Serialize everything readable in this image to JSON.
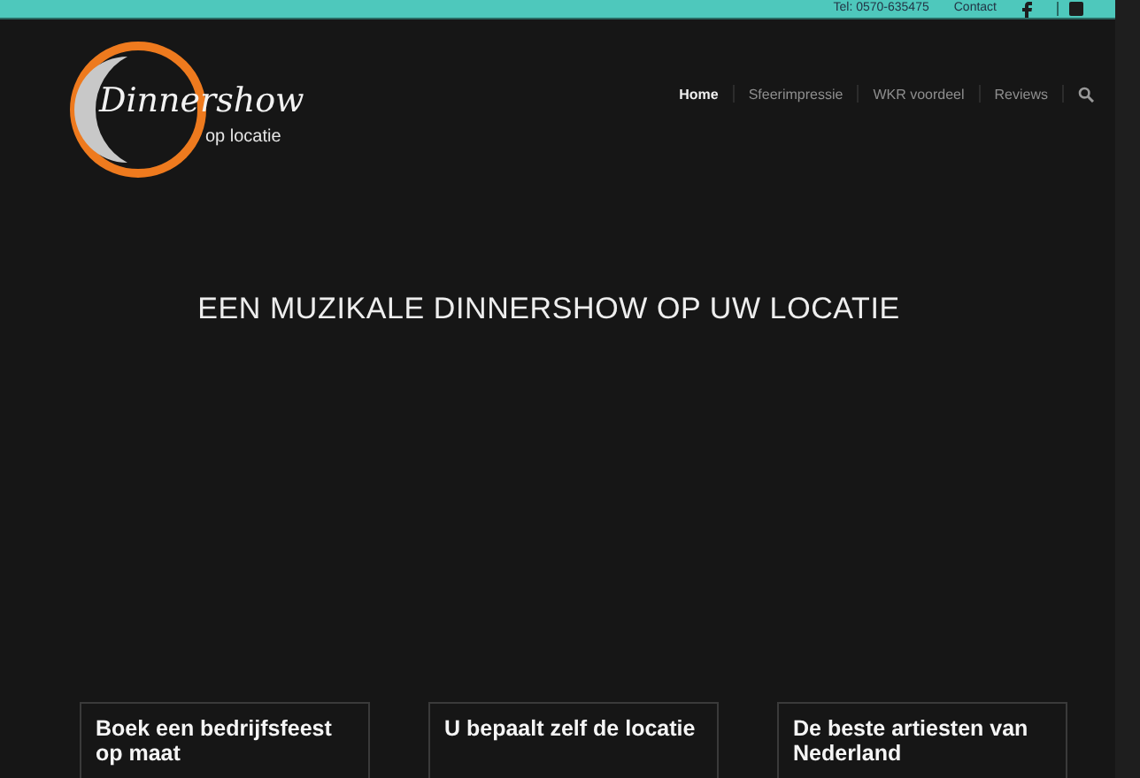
{
  "top_bar": {
    "phone": "Tel: 0570-635475",
    "contact": "Contact"
  },
  "logo": {
    "title": "Dinnershow",
    "subtitle": "op locatie"
  },
  "nav": [
    {
      "label": "Home",
      "selected": true
    },
    {
      "label": "Sfeerimpressie",
      "selected": false
    },
    {
      "label": "WKR voordeel",
      "selected": false
    },
    {
      "label": "Reviews",
      "selected": false
    }
  ],
  "headline": "EEN MUZIKALE DINNERSHOW OP UW LOCATIE",
  "cards": [
    {
      "title": "Boek een bedrijfsfeest op maat"
    },
    {
      "title": "U bepaalt zelf de locatie"
    },
    {
      "title": "De beste artiesten van Nederland"
    }
  ]
}
